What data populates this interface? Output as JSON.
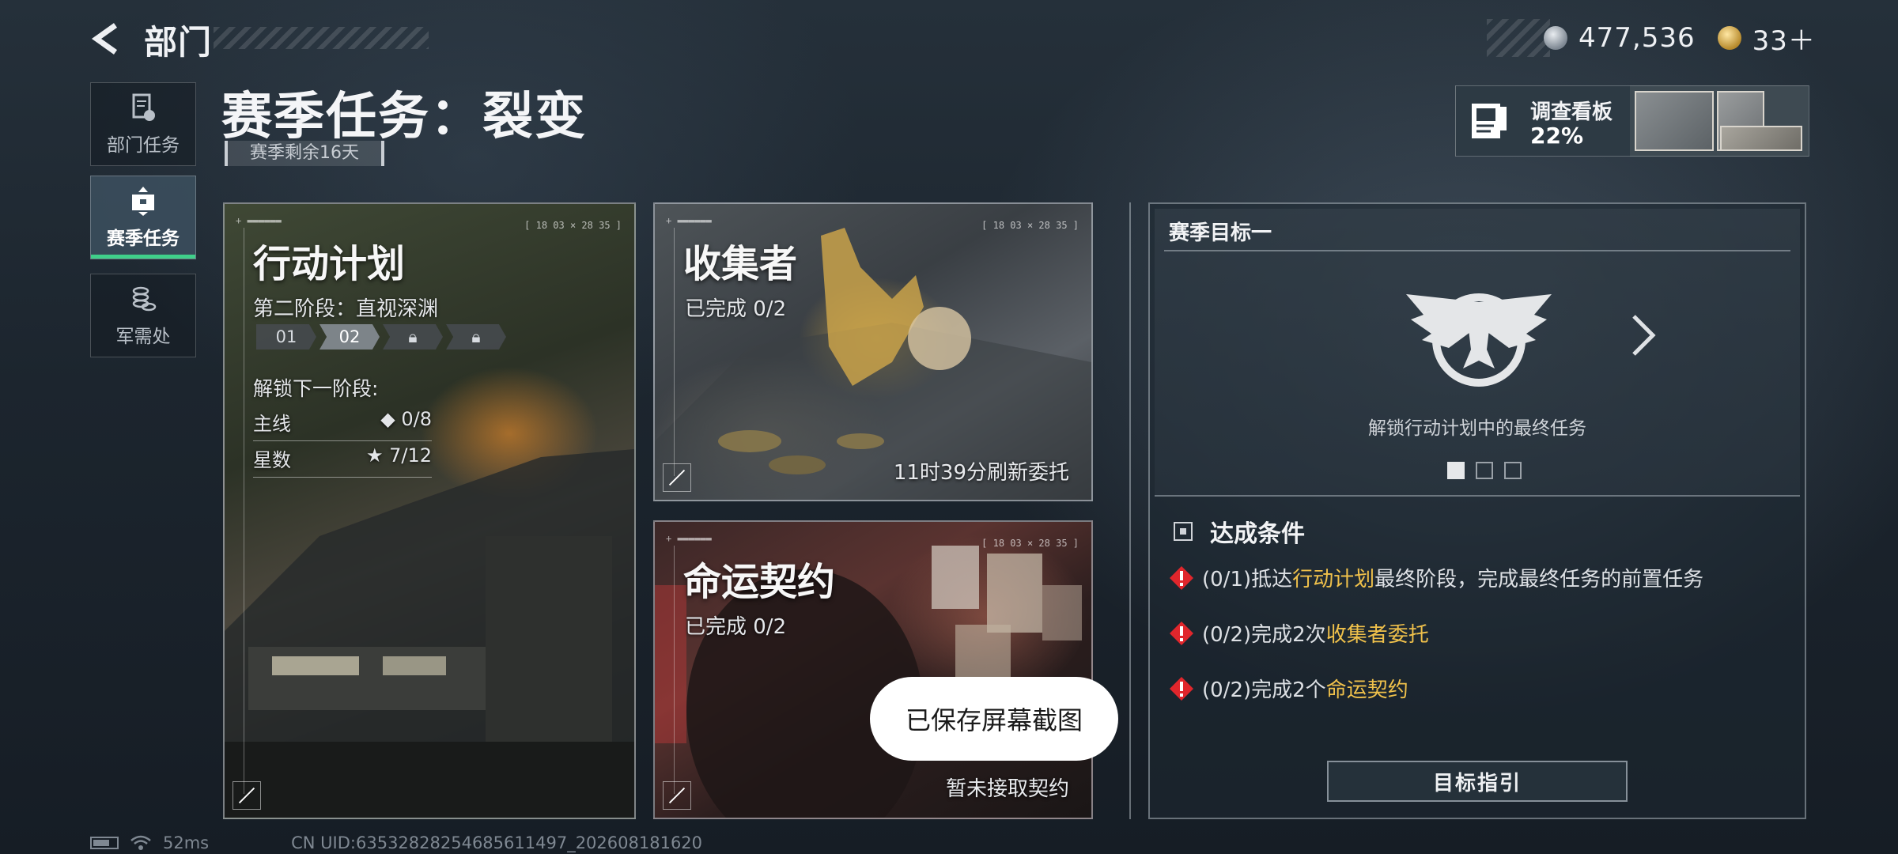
{
  "header": {
    "title": "部门",
    "currency": [
      {
        "icon": "silver-coin-icon",
        "value": "477,536"
      },
      {
        "icon": "gold-coin-icon",
        "value": "33＋"
      }
    ]
  },
  "nav": {
    "items": [
      {
        "label": "部门任务",
        "icon": "document-icon",
        "active": false
      },
      {
        "label": "赛季任务",
        "icon": "briefcase-icon",
        "active": true
      },
      {
        "label": "军需处",
        "icon": "coins-stack-icon",
        "active": false
      }
    ]
  },
  "page": {
    "title": "赛季任务：裂变",
    "remaining": "赛季剩余16天"
  },
  "board": {
    "label": "调查看板",
    "percent": "22%"
  },
  "cards": {
    "operation": {
      "title": "行动计划",
      "stage": "第二阶段：直视深渊",
      "stages": [
        "01",
        "02"
      ],
      "unlock_label": "解锁下一阶段:",
      "main_label": "主线",
      "main_value": "◆ 0/8",
      "stars_label": "星数",
      "stars_value": "★ 7/12"
    },
    "collector": {
      "title": "收集者",
      "progress": "已完成 0/2",
      "footer": "11时39分刷新委托"
    },
    "fate": {
      "title": "命运契约",
      "progress": "已完成 0/2",
      "footer": "暂未接取契约"
    },
    "coords": "[ 18 03 × 28 35 ]"
  },
  "goal": {
    "title": "赛季目标一",
    "description": "解锁行动计划中的最终任务",
    "pager_active": 0,
    "conditions_label": "达成条件",
    "conditions": [
      {
        "prefix": "(0/1)抵达",
        "highlight": "行动计划",
        "suffix": "最终阶段，完成最终任务的前置任务"
      },
      {
        "prefix": "(0/2)完成2次",
        "highlight": "收集者委托",
        "suffix": ""
      },
      {
        "prefix": "(0/2)完成2个",
        "highlight": "命运契约",
        "suffix": ""
      }
    ],
    "guide_button": "目标指引"
  },
  "toast": "已保存屏幕截图",
  "status": {
    "ping": "52ms",
    "uid": "CN UID:6353282825468561​1497_202608181620"
  },
  "colors": {
    "accent_green": "#3fd08a",
    "highlight_gold": "#f0c14b",
    "warning_red": "#e0262c"
  }
}
